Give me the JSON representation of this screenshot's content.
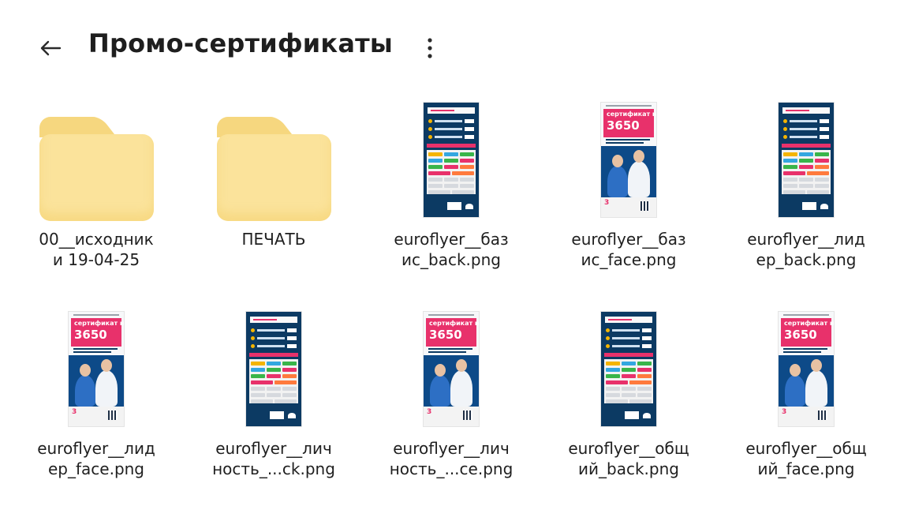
{
  "header": {
    "title": "Промо-сертификаты",
    "back_icon": "arrow-left-icon",
    "more_icon": "more-vertical-icon"
  },
  "colors": {
    "folder": "#fbe39b",
    "flyer_navy": "#0c3a63",
    "flyer_pink": "#e8316b"
  },
  "items": [
    {
      "type": "folder",
      "name_lines": [
        "00__исходник",
        "и 19-04-25"
      ]
    },
    {
      "type": "folder",
      "name_lines": [
        "ПЕЧАТЬ"
      ]
    },
    {
      "type": "image",
      "variant": "back",
      "name_lines": [
        "euroflyer__баз",
        "ис_back.png"
      ]
    },
    {
      "type": "image",
      "variant": "face",
      "name_lines": [
        "euroflyer__баз",
        "ис_face.png"
      ]
    },
    {
      "type": "image",
      "variant": "back",
      "name_lines": [
        "euroflyer__лид",
        "ер_back.png"
      ]
    },
    {
      "type": "image",
      "variant": "face",
      "name_lines": [
        "euroflyer__лид",
        "ер_face.png"
      ]
    },
    {
      "type": "image",
      "variant": "back",
      "name_lines": [
        "euroflyer__лич",
        "ность_...ck.png"
      ]
    },
    {
      "type": "image",
      "variant": "face",
      "name_lines": [
        "euroflyer__лич",
        "ность_...се.png"
      ]
    },
    {
      "type": "image",
      "variant": "back",
      "name_lines": [
        "euroflyer__общ",
        "ий_back.png"
      ]
    },
    {
      "type": "image",
      "variant": "face",
      "name_lines": [
        "euroflyer__общ",
        "ий_face.png"
      ]
    }
  ],
  "flyer_face_text": {
    "line1": "сертификат на",
    "line2": "3650"
  }
}
